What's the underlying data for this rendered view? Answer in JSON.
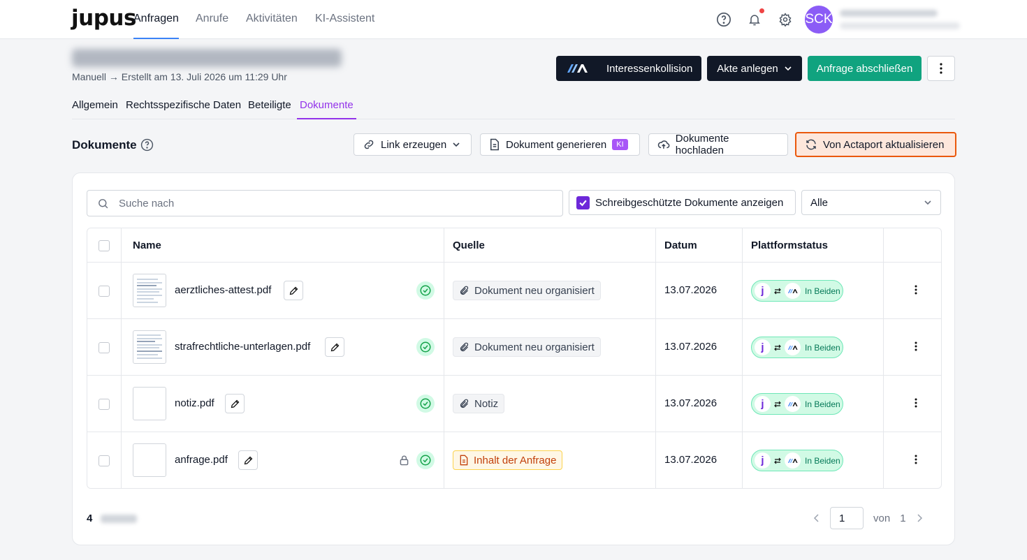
{
  "nav": {
    "logo": "jupus",
    "tabs": [
      "Anfragen",
      "Anrufe",
      "Aktivitäten",
      "KI-Assistent"
    ],
    "active_tab": "Anfragen",
    "avatar_initials": "SCK"
  },
  "header": {
    "subtitle": "Manuell → Erstellt am 13. Juli 2026 um 11:29 Uhr",
    "conflict_button": "Interessenkollision",
    "akte_button": "Akte anlegen",
    "close_button": "Anfrage abschließen"
  },
  "subtabs": [
    "Allgemein",
    "Rechtsspezifische Daten",
    "Beteiligte",
    "Dokumente"
  ],
  "active_subtab": "Dokumente",
  "section": {
    "title": "Dokumente",
    "link_button": "Link erzeugen",
    "generate_button": "Dokument generieren",
    "ki_badge": "KI",
    "upload_button": "Dokumente hochladen",
    "actaport_button": "Von Actaport aktualisieren"
  },
  "filters": {
    "search_placeholder": "Suche nach",
    "readonly_label": "Schreibgeschützte Dokumente anzeigen",
    "readonly_checked": true,
    "select_value": "Alle"
  },
  "table": {
    "headers": [
      "Name",
      "Quelle",
      "Datum",
      "Plattformstatus"
    ],
    "rows": [
      {
        "name": "aerztliches-attest.pdf",
        "source": "Dokument neu organisiert",
        "source_kind": "attachment",
        "date": "13.07.2026",
        "status": "In Beiden",
        "locked": false,
        "has_preview": true
      },
      {
        "name": "strafrechtliche-unterlagen.pdf",
        "source": "Dokument neu organisiert",
        "source_kind": "attachment",
        "date": "13.07.2026",
        "status": "In Beiden",
        "locked": false,
        "has_preview": true
      },
      {
        "name": "notiz.pdf",
        "source": "Notiz",
        "source_kind": "attachment",
        "date": "13.07.2026",
        "status": "In Beiden",
        "locked": false,
        "has_preview": false
      },
      {
        "name": "anfrage.pdf",
        "source": "Inhalt der Anfrage",
        "source_kind": "document",
        "date": "13.07.2026",
        "status": "In Beiden",
        "locked": true,
        "has_preview": false
      }
    ]
  },
  "footer": {
    "count": "4",
    "page": "1",
    "of_label": "von",
    "total_pages": "1"
  },
  "colors": {
    "accent_purple": "#9333ea",
    "green": "#10a37f",
    "dark": "#111827",
    "highlight_border": "#ea580c"
  }
}
